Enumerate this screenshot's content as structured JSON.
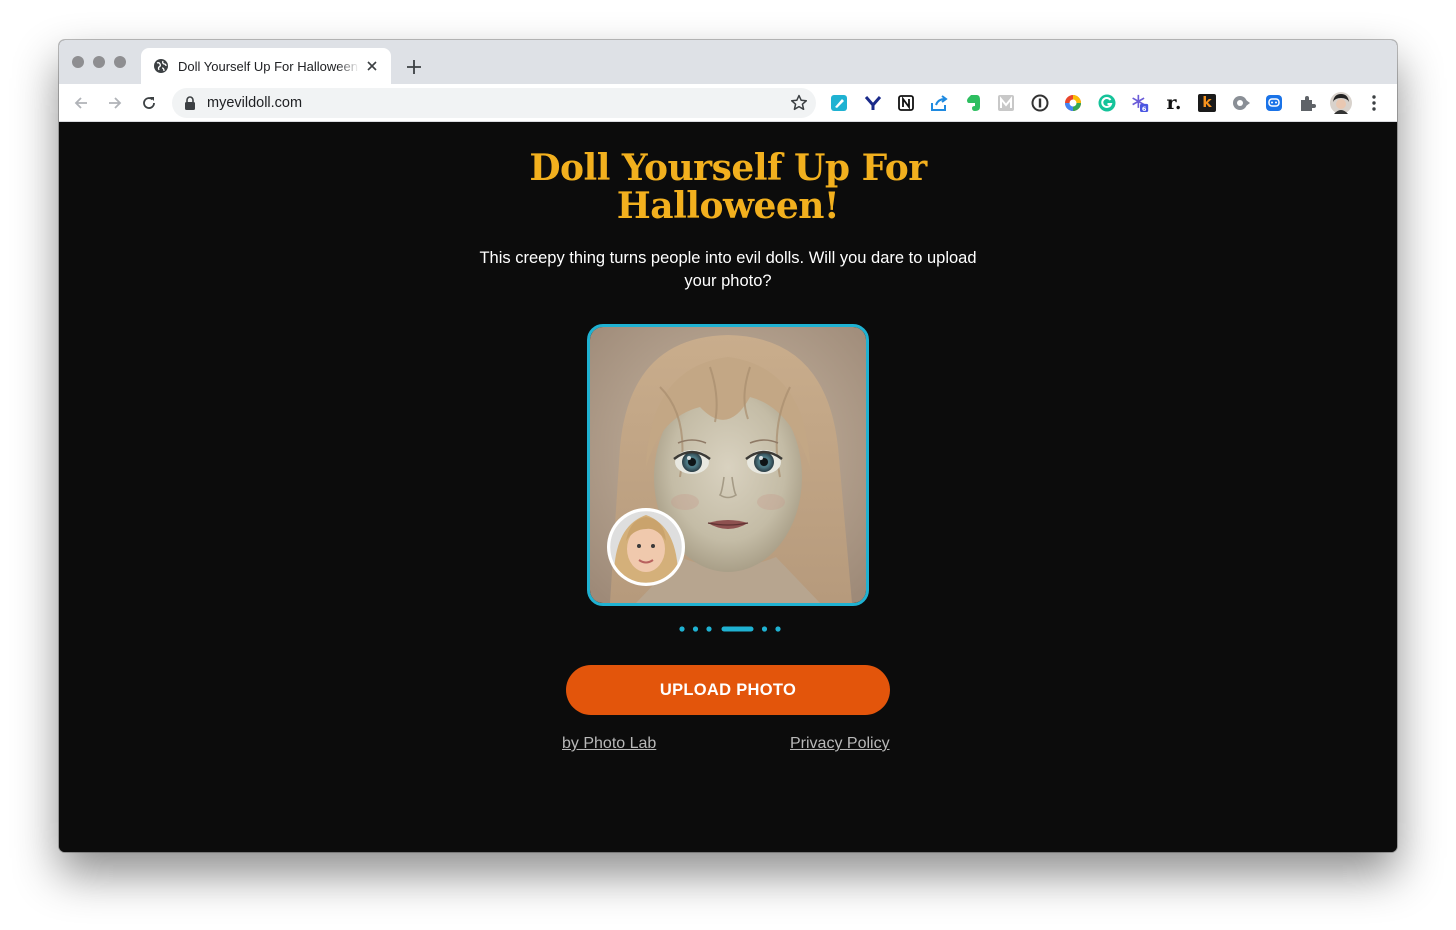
{
  "browser": {
    "tab": {
      "title": "Doll Yourself Up For Halloween",
      "favicon": "globe-icon"
    },
    "new_tab_label": "+",
    "address_bar": {
      "url": "myevildoll.com"
    },
    "extensions": [
      {
        "name": "pen-icon",
        "color": "#1fb2d2"
      },
      {
        "name": "y-icon",
        "color": "#1a2a8a"
      },
      {
        "name": "notion-icon",
        "color": "#111111"
      },
      {
        "name": "share-icon",
        "color": "#1f8ae0"
      },
      {
        "name": "evernote-icon",
        "color": "#2dbe60"
      },
      {
        "name": "m-icon",
        "color": "#b9b9b9"
      },
      {
        "name": "1password-icon",
        "color": "#333333"
      },
      {
        "name": "color-wheel-icon",
        "color": "#e8452c"
      },
      {
        "name": "grammarly-icon",
        "color": "#15c39a"
      },
      {
        "name": "snowflake-icon",
        "color": "#6a5bd8",
        "badge": "6"
      },
      {
        "name": "readwise-icon",
        "label": "r.",
        "color": "#111111"
      },
      {
        "name": "k-icon",
        "label": "k",
        "color": "#f7931e"
      },
      {
        "name": "record-icon",
        "color": "#8a8f96"
      },
      {
        "name": "chat-icon",
        "color": "#1a73e8"
      },
      {
        "name": "puzzle-icon",
        "color": "#5f6368"
      },
      {
        "name": "profile-avatar",
        "color": "#333333"
      }
    ]
  },
  "page": {
    "title": "Doll Yourself Up For Halloween!",
    "subtitle": "This creepy thing turns people into evil dolls. Will you dare to upload your photo?",
    "carousel": {
      "count": 6,
      "active_index": 3,
      "color": "#1fb2d2"
    },
    "upload_button": "UPLOAD PHOTO",
    "links": {
      "by": "by Photo Lab",
      "privacy": "Privacy Policy"
    },
    "colors": {
      "title": "#f2b01e",
      "button": "#e3550b",
      "accent": "#1fb2d2",
      "background": "#0c0c0c"
    }
  }
}
